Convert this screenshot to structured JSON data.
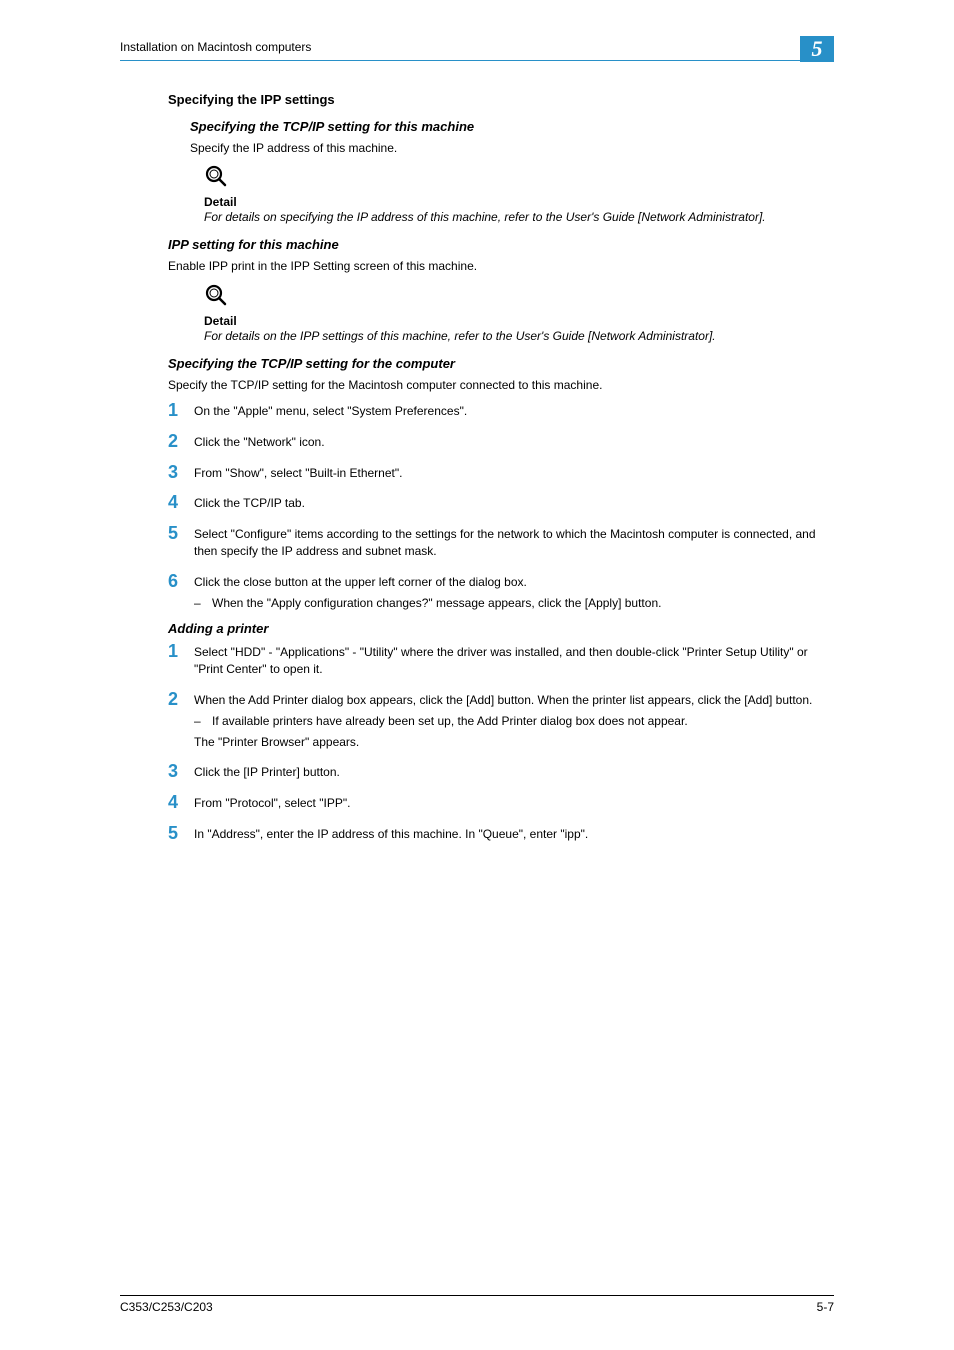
{
  "header": {
    "title": "Installation on Macintosh computers",
    "chapter_num": "5"
  },
  "sec": {
    "heading1": "Specifying the IPP settings",
    "sub1_heading": "Specifying the TCP/IP setting for this machine",
    "sub1_body": "Specify the IP address of this machine.",
    "detail1_label": "Detail",
    "detail1_text": "For details on specifying the IP address of this machine, refer to the User's Guide [Network Administrator].",
    "sub2_heading": "IPP setting for this machine",
    "sub2_body": "Enable IPP print in the IPP Setting screen of this machine.",
    "detail2_label": "Detail",
    "detail2_text": "For details on the IPP settings of this machine, refer to the User's Guide [Network Administrator].",
    "sub3_heading": "Specifying the TCP/IP setting for the computer",
    "sub3_body": "Specify the TCP/IP setting for the Macintosh computer connected to this machine.",
    "steps_a": [
      {
        "n": "1",
        "t": "On the \"Apple\" menu, select \"System Preferences\"."
      },
      {
        "n": "2",
        "t": "Click the \"Network\" icon."
      },
      {
        "n": "3",
        "t": "From \"Show\", select \"Built-in Ethernet\"."
      },
      {
        "n": "4",
        "t": "Click the TCP/IP tab."
      },
      {
        "n": "5",
        "t": "Select \"Configure\" items according to the settings for the network to which the Macintosh computer is connected, and then specify the IP address and subnet mask."
      },
      {
        "n": "6",
        "t": "Click the close button at the upper left corner of the dialog box."
      }
    ],
    "step6_sub": "When the \"Apply configuration changes?\" message appears, click the [Apply] button.",
    "sub4_heading": "Adding a printer",
    "steps_b": [
      {
        "n": "1",
        "t": "Select \"HDD\" - \"Applications\" - \"Utility\" where the driver was installed, and then double-click \"Printer Setup Utility\" or \"Print Center\" to open it."
      },
      {
        "n": "2",
        "t": "When the Add Printer dialog box appears, click the [Add] button. When the printer list appears, click the [Add] button."
      },
      {
        "n": "3",
        "t": "Click the [IP Printer] button."
      },
      {
        "n": "4",
        "t": "From \"Protocol\", select \"IPP\"."
      },
      {
        "n": "5",
        "t": "In \"Address\", enter the IP address of this machine. In \"Queue\", enter \"ipp\"."
      }
    ],
    "stepb2_sub": "If available printers have already been set up, the Add Printer dialog box does not appear.",
    "stepb2_after": "The \"Printer Browser\" appears."
  },
  "footer": {
    "left": "C353/C253/C203",
    "right": "5-7"
  }
}
